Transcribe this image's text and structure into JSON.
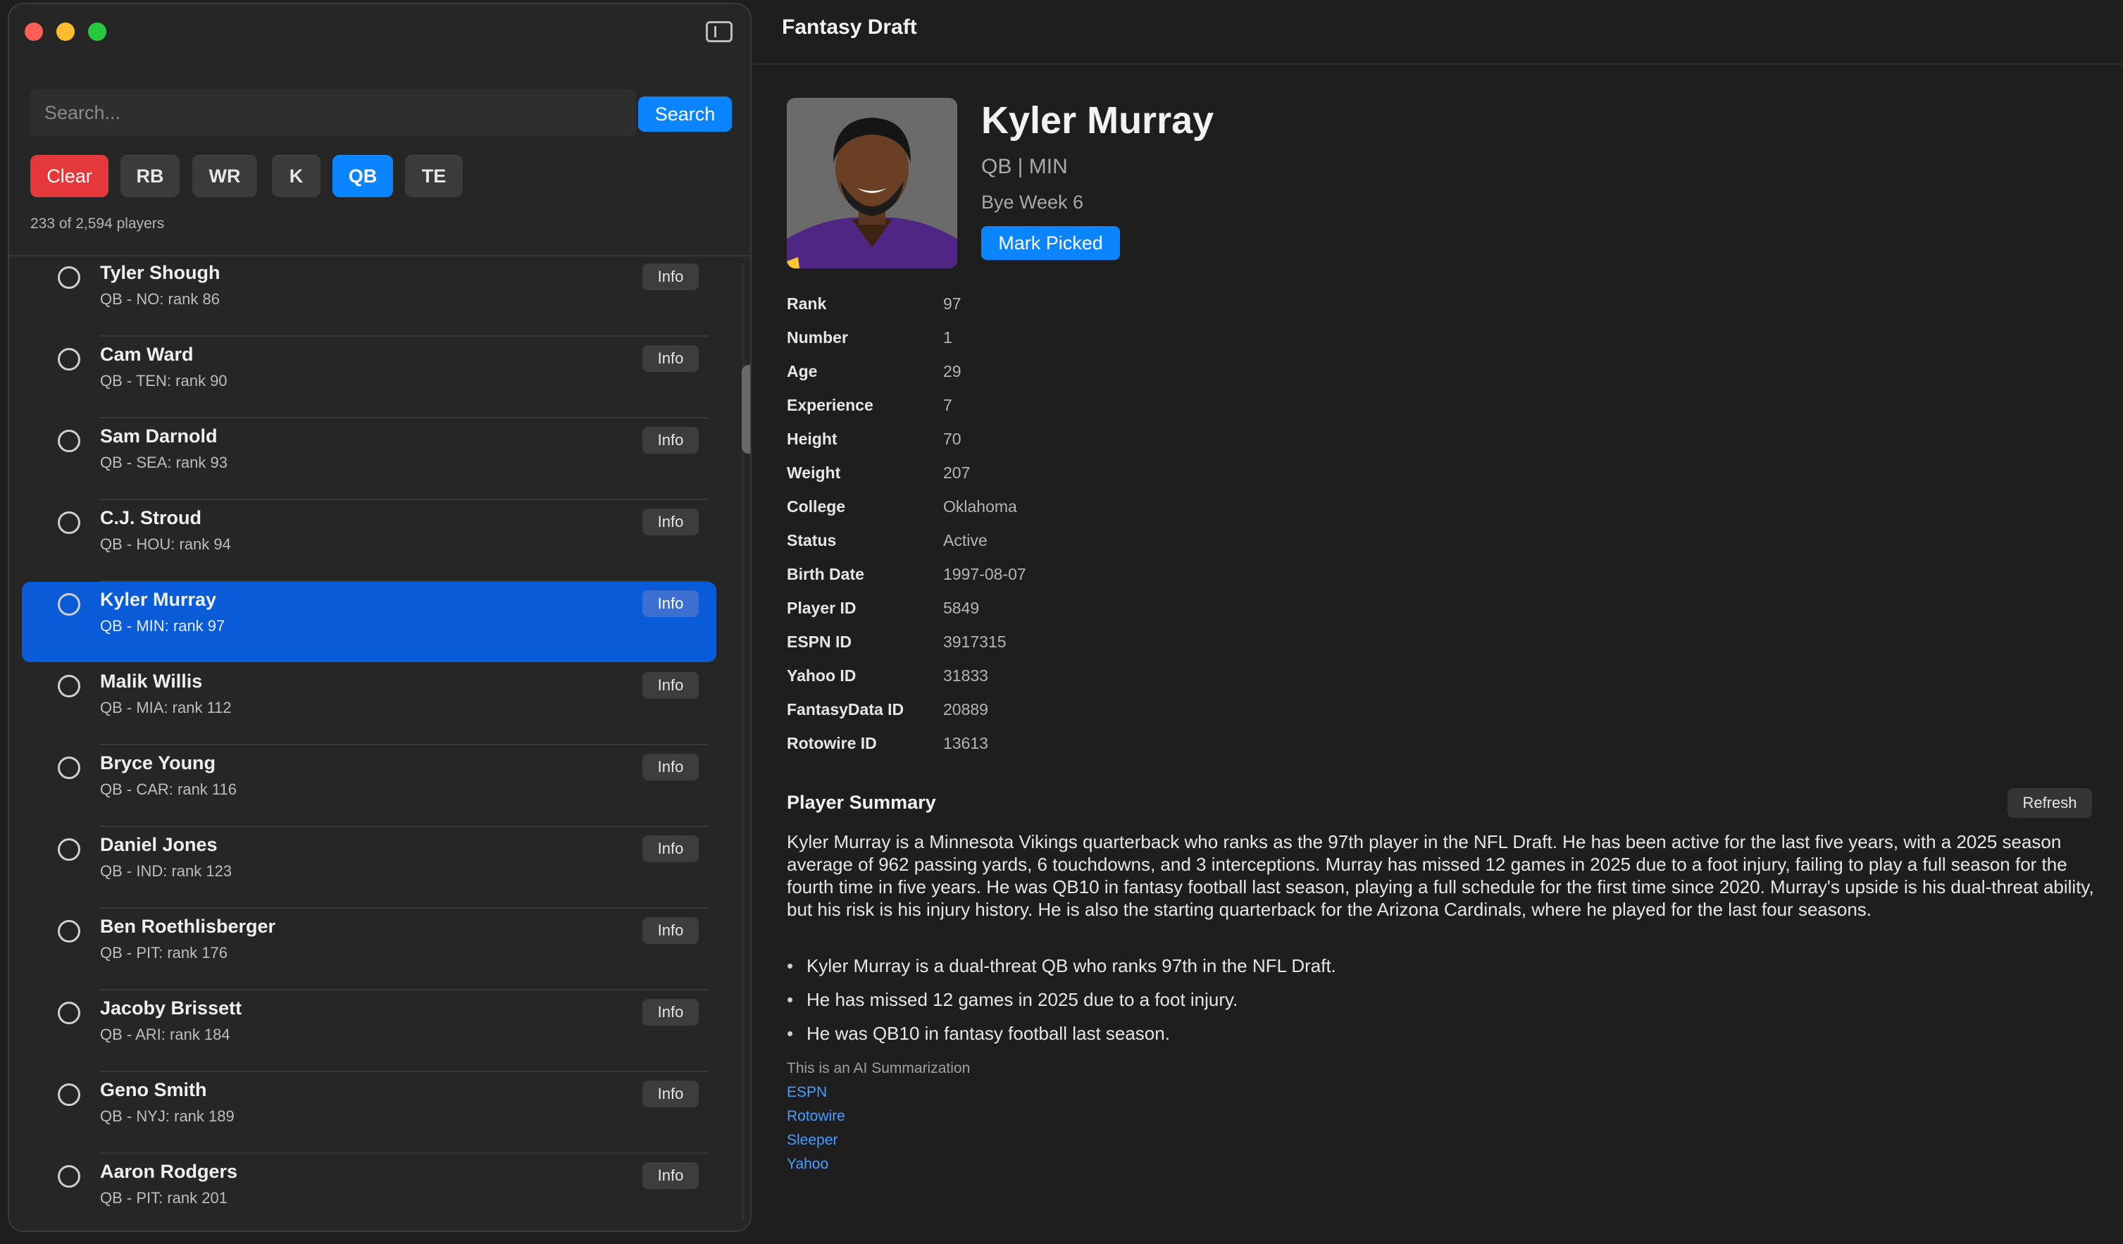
{
  "window": {
    "title": "Fantasy Draft"
  },
  "colors": {
    "accent": "#0a84ff",
    "clear": "#e5383b",
    "selected_row": "#0a5bd7",
    "link": "#4a9dff"
  },
  "sidebar": {
    "search": {
      "placeholder": "Search...",
      "value": "",
      "button_label": "Search"
    },
    "filters": {
      "clear_label": "Clear",
      "positions": [
        "RB",
        "WR",
        "K",
        "QB",
        "TE"
      ],
      "active": "QB"
    },
    "count_text": "233 of 2,594 players",
    "info_label": "Info",
    "players": [
      {
        "name": "Tyler Shough",
        "sub": "QB - NO: rank 86"
      },
      {
        "name": "Cam Ward",
        "sub": "QB - TEN: rank 90"
      },
      {
        "name": "Sam Darnold",
        "sub": "QB - SEA: rank 93"
      },
      {
        "name": "C.J. Stroud",
        "sub": "QB - HOU: rank 94"
      },
      {
        "name": "Kyler Murray",
        "sub": "QB - MIN: rank 97",
        "selected": true
      },
      {
        "name": "Malik Willis",
        "sub": "QB - MIA: rank 112"
      },
      {
        "name": "Bryce Young",
        "sub": "QB - CAR: rank 116"
      },
      {
        "name": "Daniel Jones",
        "sub": "QB - IND: rank 123"
      },
      {
        "name": "Ben Roethlisberger",
        "sub": "QB - PIT: rank 176"
      },
      {
        "name": "Jacoby Brissett",
        "sub": "QB - ARI: rank 184"
      },
      {
        "name": "Geno Smith",
        "sub": "QB - NYJ: rank 189"
      },
      {
        "name": "Aaron Rodgers",
        "sub": "QB - PIT: rank 201"
      }
    ]
  },
  "detail": {
    "name": "Kyler Murray",
    "position_team": "QB | MIN",
    "bye": "Bye Week 6",
    "mark_picked_label": "Mark Picked",
    "stats": [
      {
        "label": "Rank",
        "value": "97"
      },
      {
        "label": "Number",
        "value": "1"
      },
      {
        "label": "Age",
        "value": "29"
      },
      {
        "label": "Experience",
        "value": "7"
      },
      {
        "label": "Height",
        "value": "70"
      },
      {
        "label": "Weight",
        "value": "207"
      },
      {
        "label": "College",
        "value": "Oklahoma"
      },
      {
        "label": "Status",
        "value": "Active"
      },
      {
        "label": "Birth Date",
        "value": "1997-08-07"
      },
      {
        "label": "Player ID",
        "value": "5849"
      },
      {
        "label": "ESPN ID",
        "value": "3917315"
      },
      {
        "label": "Yahoo ID",
        "value": "31833"
      },
      {
        "label": "FantasyData ID",
        "value": "20889"
      },
      {
        "label": "Rotowire ID",
        "value": "13613"
      }
    ],
    "summary": {
      "title": "Player Summary",
      "refresh_label": "Refresh",
      "text": "Kyler Murray is a Minnesota Vikings quarterback who ranks as the 97th player in the NFL Draft. He has been active for the last five years, with a 2025 season average of 962 passing yards, 6 touchdowns, and 3 interceptions. Murray has missed 12 games in 2025 due to a foot injury, failing to play a full season for the fourth time in five years. He was QB10 in fantasy football last season, playing a full schedule for the first time since 2020. Murray's upside is his dual-threat ability, but his risk is his injury history. He is also the starting quarterback for the Arizona Cardinals, where he played for the last four seasons.",
      "bullets": [
        "Kyler Murray is a dual-threat QB who ranks 97th in the NFL Draft.",
        "He has missed 12 games in 2025 due to a foot injury.",
        "He was QB10 in fantasy football last season."
      ],
      "ai_note": "This is an AI Summarization",
      "links": [
        "ESPN",
        "Rotowire",
        "Sleeper",
        "Yahoo"
      ]
    }
  }
}
